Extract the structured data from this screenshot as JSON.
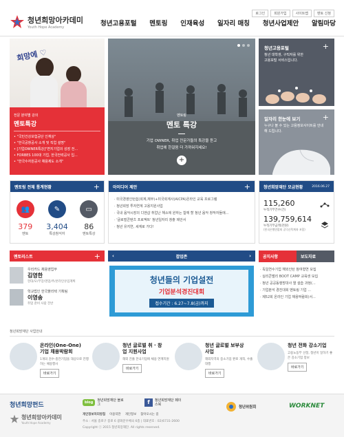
{
  "header": {
    "logo_title": "청년희망아카데미",
    "logo_sub": "Youth Hope Academy",
    "util_links": [
      "로그인",
      "회원가입",
      "사이트맵",
      "멘토 신청"
    ],
    "nav": [
      "청년고용포털",
      "멘토링",
      "인재육성",
      "일자리 매칭",
      "청년사업제안",
      "알림마당"
    ]
  },
  "hero": {
    "left": {
      "mini": "전문 분야별 강의",
      "title": "멘토특강",
      "items": [
        "\"국민건강보험공단 인재상\"",
        "\"한국공항공사 소개 및 직업 설명\"",
        "[기업OWNER특강]\"변지기업의 성장 전...",
        "FORBES 100대 기업, 한국전력공사 입...",
        "\"한국수자원공사 채용제도 소개\""
      ]
    },
    "center": {
      "mini": "멘토링",
      "title": "멘토 특강",
      "desc1": "기업 OWNER, 취업 전문가들의 특강을 듣고",
      "desc2": "취업에 한걸음 더 가까워지세요!"
    },
    "right_top": {
      "title": "청년고용포털",
      "desc": "청년 대학생, 구직자를 위한 고용포털 서비스입니다."
    },
    "right_bottom": {
      "title": "일자리 한눈에 보기",
      "desc": "누구나 볼 수 있는 고용정보사이트를 안내해 드립니다."
    }
  },
  "stats_panel": {
    "title": "멘토링 전체 통계현황",
    "items": [
      {
        "value": "379",
        "label": "멘토"
      },
      {
        "value": "3,404",
        "label": "특강참석자"
      },
      {
        "value": "86",
        "label": "멘토특강"
      }
    ]
  },
  "idea_panel": {
    "title": "아이디어 제안",
    "items": [
      "미국경영인턴쉽(회계,재무)+미국회계사(AICPA)온라인 교육 프로그램",
      "청년희망 투자연계 고용지원사업",
      "국내 음악시장의 디앤샵 취업난 해소에 원하는 함께 할 청년 음악 창작자들에...",
      "'글로벌콘텐츠 프로젝트' 청년일자리 창출 제안서",
      "청년 유지연, 세계로 가다!"
    ]
  },
  "fund_panel": {
    "title": "청년희망재단 모금현황",
    "date": "2016.06.27",
    "count": "115,260",
    "count_label": "누적기부건수(건)",
    "amount": "139,759,614",
    "amount_label": "누적기부금액(천원)",
    "amount_note": "(한국은행연합회 공익신탁계좌 포함)"
  },
  "mentor_list": {
    "title": "멘토리스트",
    "mentors": [
      {
        "org": "우리카드 채용영업부",
        "name": "김영한",
        "desc": "현대/모/부장/영업/추/온라인유입계획"
      },
      {
        "org": "학교법인 한국폴리텍 기획팀",
        "name": "이영송",
        "desc": "취업 준비 사람 전반"
      }
    ]
  },
  "popup_zone": {
    "title": "팝업존",
    "main": "청년들의 기업설전",
    "sub": "기업분석경진대회",
    "period": "접수기간 : 6.27~7.8(금)까지"
  },
  "notice": {
    "tabs": [
      "공지사항",
      "보도자료"
    ],
    "items": [
      "독일연수기업 해외인턴 참여형연 모집",
      "실리콘밸리 BOOT CAMP 교육생 모집",
      "청년 공공동행방대사 열 설습 과정(...",
      "기업분석 경진대회 멘토링 기업 ...",
      "제52회 온라인 기업 채용박람회(서... "
    ]
  },
  "programs": {
    "caption": "청년희망재단 사업안내",
    "cards": [
      {
        "title": "온라인(One-One)\n기업 채용박람회",
        "desc": "1개의 검수-충전기업을 대상으로 진행하는 채용행사",
        "btn": "바로가기"
      },
      {
        "title": "청년 글로벌 취 · 창\n업 지원사업",
        "desc": "해외 진출 한국기업에 채용 연계지원",
        "btn": "바로가기"
      },
      {
        "title": "청년 글로벌 보부상\n사업",
        "desc": "해외지역의 중소기업 판로 개척, 수출대행",
        "btn": "바로가기"
      },
      {
        "title": "청년 전화 강소기업",
        "desc": "고용노동부 선정, 청년이 일하기 좋은 강소기업 정보",
        "btn": "바로가기"
      }
    ]
  },
  "footer": {
    "fund_logo": "청년희망펀드",
    "academy_logo": "청년희망아카데미",
    "academy_sub": "Youth Hope Academy",
    "blog_label": "blog",
    "blog_title": "청년희망재단 블로그",
    "fb_title": "청년희망재단 페이스북",
    "links": [
      "개인정보처리방침",
      "이용약관",
      "개인정보",
      "찾아오시는 길"
    ],
    "address": "주소 : 서울 종로구 종로 6 광화문우체국 6층 | 대표번호 : 02)6731-2600",
    "copyright": "Copyright ⓒ 2015 청년희망재단. All rights reserved.",
    "partner1": "청년위원회",
    "partner2": "WORKNET"
  },
  "colors": {
    "red": "#e53138",
    "navy": "#214c86",
    "blue": "#1b7fc4",
    "gray": "#545a65"
  }
}
